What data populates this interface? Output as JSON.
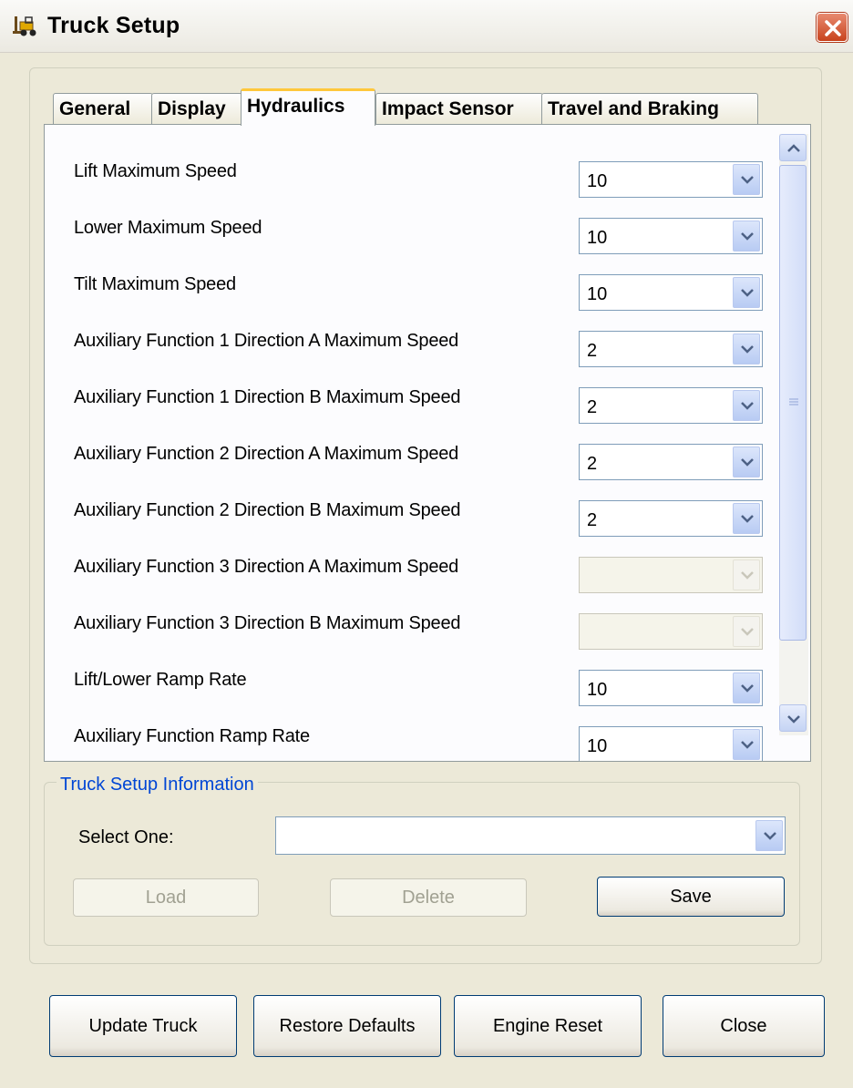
{
  "window": {
    "title": "Truck Setup",
    "title_icon": "forklift-icon",
    "close_icon": "close-icon"
  },
  "tabs": [
    {
      "label": "General",
      "active": false
    },
    {
      "label": "Display",
      "active": false
    },
    {
      "label": "Hydraulics",
      "active": true
    },
    {
      "label": "Impact Sensor",
      "active": false
    },
    {
      "label": "Travel and Braking",
      "active": false
    }
  ],
  "hydraulics": {
    "rows": [
      {
        "label": "Lift Maximum Speed",
        "value": "10",
        "enabled": true
      },
      {
        "label": "Lower Maximum Speed",
        "value": "10",
        "enabled": true
      },
      {
        "label": "Tilt Maximum Speed",
        "value": "10",
        "enabled": true
      },
      {
        "label": "Auxiliary Function 1 Direction A Maximum Speed",
        "value": "2",
        "enabled": true
      },
      {
        "label": "Auxiliary Function 1 Direction B Maximum Speed",
        "value": "2",
        "enabled": true
      },
      {
        "label": "Auxiliary Function 2 Direction A Maximum Speed",
        "value": "2",
        "enabled": true
      },
      {
        "label": "Auxiliary Function 2 Direction B Maximum Speed",
        "value": "2",
        "enabled": true
      },
      {
        "label": "Auxiliary Function 3 Direction A Maximum Speed",
        "value": "",
        "enabled": false
      },
      {
        "label": "Auxiliary Function 3 Direction B Maximum Speed",
        "value": "",
        "enabled": false
      },
      {
        "label": "Lift/Lower Ramp Rate",
        "value": "10",
        "enabled": true
      },
      {
        "label": "Auxiliary Function Ramp Rate",
        "value": "10",
        "enabled": true
      }
    ]
  },
  "info": {
    "legend": "Truck Setup Information",
    "select_label": "Select One:",
    "select_value": "",
    "load_label": "Load",
    "delete_label": "Delete",
    "save_label": "Save"
  },
  "footer": {
    "update_label": "Update Truck",
    "restore_label": "Restore Defaults",
    "engine_reset_label": "Engine Reset",
    "close_label": "Close"
  },
  "colors": {
    "window_bg": "#ece9d8",
    "legend_text": "#0046d5",
    "active_tab_accent": "#ffc83c",
    "close_button": "#c8431d"
  }
}
